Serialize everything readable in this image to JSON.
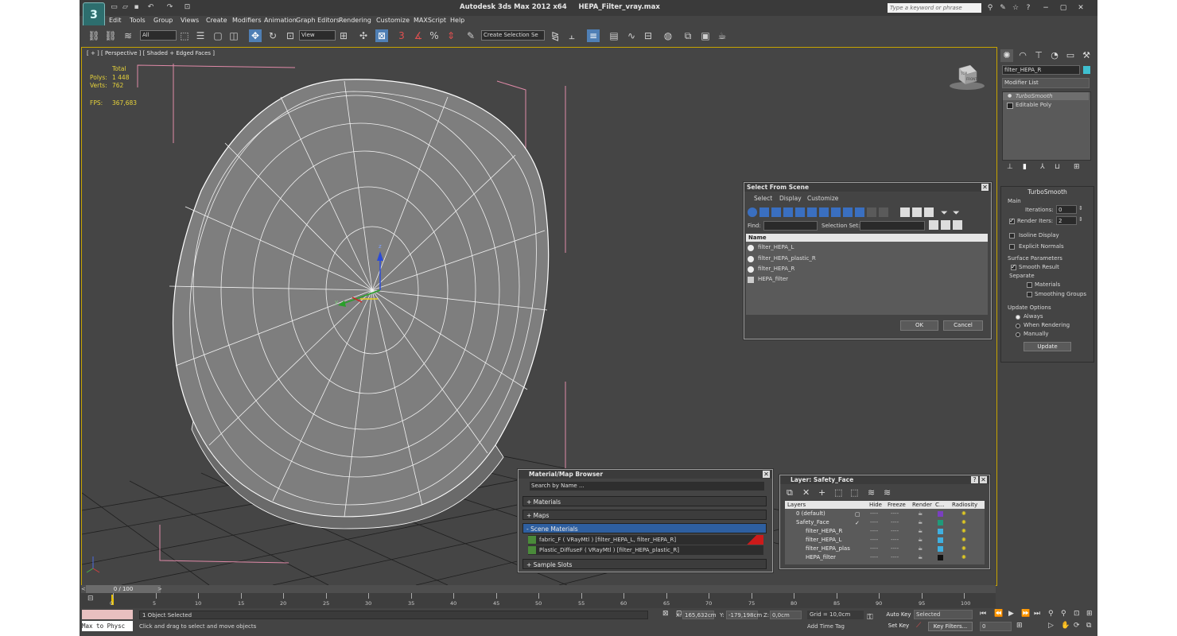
{
  "titlebar": {
    "logo": "3",
    "app_title": "Autodesk 3ds Max  2012 x64",
    "file_name": "HEPA_Filter_vray.max",
    "search_placeholder": "Type a keyword or phrase"
  },
  "menu": [
    "Edit",
    "Tools",
    "Group",
    "Views",
    "Create",
    "Modifiers",
    "Animation",
    "Graph Editors",
    "Rendering",
    "Customize",
    "MAXScript",
    "Help"
  ],
  "toolbar": {
    "filter_value": "All",
    "refcoord_value": "View",
    "selection_set_placeholder": "Create Selection Se",
    "snap_label": "3",
    "percent_snap": "%"
  },
  "viewport": {
    "label": "[ + ] [ Perspective ] [ Shaded + Edged Faces ]",
    "stats": {
      "total_label": "Total",
      "polys_label": "Polys:",
      "polys_value": "1 448",
      "verts_label": "Verts:",
      "verts_value": "762",
      "fps_label": "FPS:",
      "fps_value": "367,683"
    },
    "viewcube_top": "TOP",
    "viewcube_front": "FRONT"
  },
  "command_panel": {
    "object_name": "filter_HEPA_R",
    "modifier_list": "Modifier List",
    "stack": [
      "TurboSmooth",
      "Editable Poly"
    ],
    "rollout_title": "TurboSmooth",
    "main_label": "Main",
    "iterations_label": "Iterations:",
    "iterations_value": "0",
    "render_iters_label": "Render Iters:",
    "render_iters_value": "2",
    "isoline_label": "Isoline Display",
    "explicit_label": "Explicit Normals",
    "surface_label": "Surface Parameters",
    "smooth_result_label": "Smooth Result",
    "separate_label": "Separate",
    "materials_label": "Materials",
    "smoothing_groups_label": "Smoothing Groups",
    "update_options_label": "Update Options",
    "always_label": "Always",
    "when_rendering_label": "When Rendering",
    "manually_label": "Manually",
    "update_button": "Update"
  },
  "select_from_scene": {
    "title": "Select From Scene",
    "menus": [
      "Select",
      "Display",
      "Customize"
    ],
    "find_label": "Find:",
    "selection_set_label": "Selection Set:",
    "column_name": "Name",
    "items": [
      "filter_HEPA_L",
      "filter_HEPA_plastic_R",
      "filter_HEPA_R",
      "HEPA_filter"
    ],
    "ok": "OK",
    "cancel": "Cancel"
  },
  "material_browser": {
    "title": "Material/Map Browser",
    "search_placeholder": "Search by Name ...",
    "sections": [
      "+ Materials",
      "+ Maps",
      "- Scene Materials"
    ],
    "scene_materials": [
      "fabric_F  ( VRayMtl ) [filter_HEPA_L, filter_HEPA_R]",
      "Plastic_DiffuseF  ( VRayMtl ) [filter_HEPA_plastic_R]"
    ],
    "sample_slots": "+ Sample Slots"
  },
  "layer_dialog": {
    "title": "Layer: Safety_Face",
    "columns": [
      "Layers",
      "Hide",
      "Freeze",
      "Render",
      "C...",
      "Radiosity"
    ],
    "rows": [
      {
        "name": "0 (default)",
        "color": "#7a3fc0"
      },
      {
        "name": "Safety_Face",
        "color": "#1f9a7a"
      },
      {
        "name": "filter_HEPA_R",
        "color": "#3fb0e0"
      },
      {
        "name": "filter_HEPA_L",
        "color": "#3fb0e0"
      },
      {
        "name": "filter_HEPA_plas",
        "color": "#3fb0e0"
      },
      {
        "name": "HEPA_filter",
        "color": "#111111"
      }
    ],
    "dash": "----"
  },
  "timeline": {
    "frame_display": "0 / 100",
    "ticks": [
      "0",
      "5",
      "10",
      "15",
      "20",
      "25",
      "30",
      "35",
      "40",
      "45",
      "50",
      "55",
      "60",
      "65",
      "70",
      "75",
      "80",
      "85",
      "90",
      "95",
      "100"
    ]
  },
  "statusbar": {
    "maxscript_label": "Max to Physc",
    "selection_status": "1 Object Selected",
    "prompt": "Click and drag to select and move objects",
    "x_label": "X:",
    "x_value": "165,632cm",
    "y_label": "Y:",
    "y_value": "-179,198cm",
    "z_label": "Z:",
    "z_value": "0,0cm",
    "grid": "Grid = 10,0cm",
    "add_time_tag": "Add Time Tag",
    "auto_key": "Auto Key",
    "set_key": "Set Key",
    "selected": "Selected",
    "key_filters": "Key Filters...",
    "frame_value": "0"
  }
}
